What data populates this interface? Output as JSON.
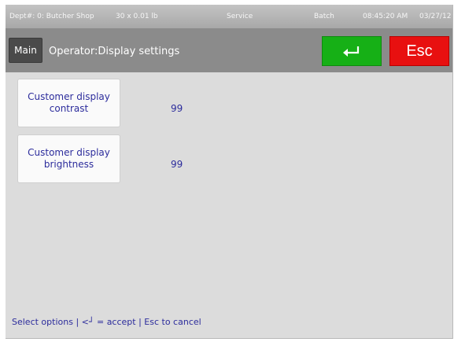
{
  "statusbar": {
    "dept": "Dept#: 0: Butcher Shop",
    "unit": "30 x 0.01 lb",
    "mode": "Service",
    "batch": "Batch",
    "time": "08:45:20 AM",
    "date": "03/27/12"
  },
  "header": {
    "main_label": "Main",
    "title": "Operator:Display settings",
    "enter_icon": "enter-icon",
    "esc_label": "Esc",
    "enter_color": "#16b016",
    "esc_color": "#e81010"
  },
  "settings": [
    {
      "label": "Customer display contrast",
      "value": "99"
    },
    {
      "label": "Customer display brightness",
      "value": "99"
    }
  ],
  "footer": {
    "hint": "Select options | <┘ = accept | Esc to cancel"
  }
}
